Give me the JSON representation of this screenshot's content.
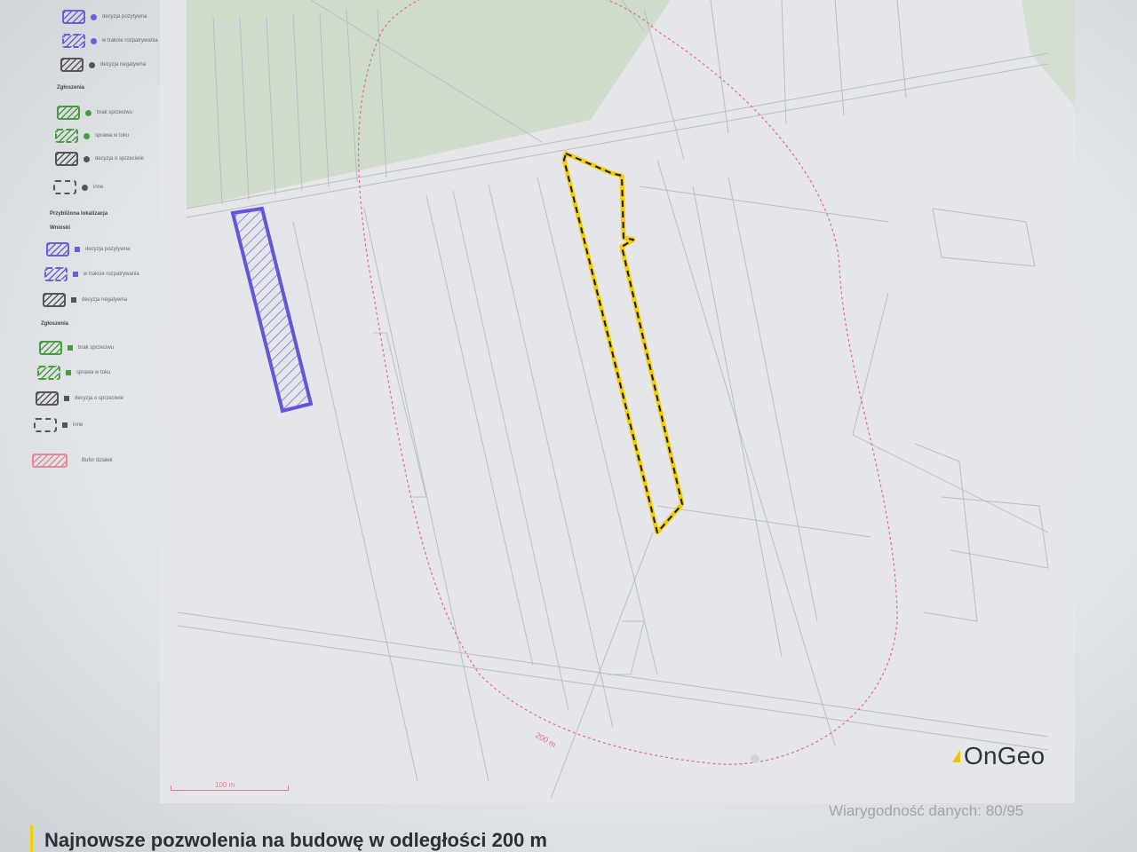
{
  "legend": {
    "top_items": [
      {
        "label": "decyzja pozytywna",
        "color": "#6c5fd6",
        "style": "hatched-solid",
        "marker": "dot"
      },
      {
        "label": "w trakcie rozpatrywania",
        "color": "#6c5fd6",
        "style": "hatched-dashed",
        "marker": "dot"
      },
      {
        "label": "decyzja negatywna",
        "color": "#555555",
        "style": "hatched-solid",
        "marker": "dot"
      }
    ],
    "section1_heading": "Zgłoszenia",
    "section1_items": [
      {
        "label": "brak sprzeciwu",
        "color": "#4a9a44",
        "style": "hatched-solid",
        "marker": "dot"
      },
      {
        "label": "sprawa w toku",
        "color": "#4a9a44",
        "style": "hatched-dashed",
        "marker": "dot"
      },
      {
        "label": "decyzja o sprzeciwie",
        "color": "#555555",
        "style": "hatched-solid",
        "marker": "dot"
      },
      {
        "label": "inne",
        "color": "#555555",
        "style": "dashed-empty",
        "marker": "dot"
      }
    ],
    "section2_heading": "Przybliżona lokalizacja",
    "section2_sub": "Wnioski",
    "section2_items": [
      {
        "label": "decyzja pozytywna",
        "color": "#6c5fd6",
        "style": "hatched-solid",
        "marker": "square"
      },
      {
        "label": "w trakcie rozpatrywania",
        "color": "#6c5fd6",
        "style": "hatched-dashed",
        "marker": "square"
      },
      {
        "label": "decyzja negatywna",
        "color": "#555555",
        "style": "hatched-solid",
        "marker": "square"
      }
    ],
    "section3_heading": "Zgłoszenia",
    "section3_items": [
      {
        "label": "brak sprzeciwu",
        "color": "#4a9a44",
        "style": "hatched-solid",
        "marker": "square"
      },
      {
        "label": "sprawa w toku",
        "color": "#4a9a44",
        "style": "hatched-dashed",
        "marker": "square"
      },
      {
        "label": "decyzja o sprzeciwie",
        "color": "#555555",
        "style": "hatched-solid",
        "marker": "square"
      },
      {
        "label": "inne",
        "color": "#555555",
        "style": "dashed-empty",
        "marker": "square"
      }
    ],
    "buffer_item": {
      "label": "Bufor działek",
      "color": "#e48a9a",
      "style": "hatched-solid"
    }
  },
  "map": {
    "buffer_label": "200 m",
    "scale_label": "100 m",
    "colors": {
      "background": "#e4e6e9",
      "forest": "#cfdccc",
      "parcel_lines": "#b9bcc1",
      "buffer": "#e06a82",
      "permit_polygon": "#6655d8",
      "subject_parcel_fill": "#f2cc00",
      "subject_parcel_dash": "#1a1a1a"
    }
  },
  "logo": {
    "text": "OnGeo",
    "icon": "triangle-logo-icon"
  },
  "reliability_text": "Wiarygodność danych: 80/95",
  "section_heading": "Najnowsze pozwolenia na budowę w odległości 200 m"
}
